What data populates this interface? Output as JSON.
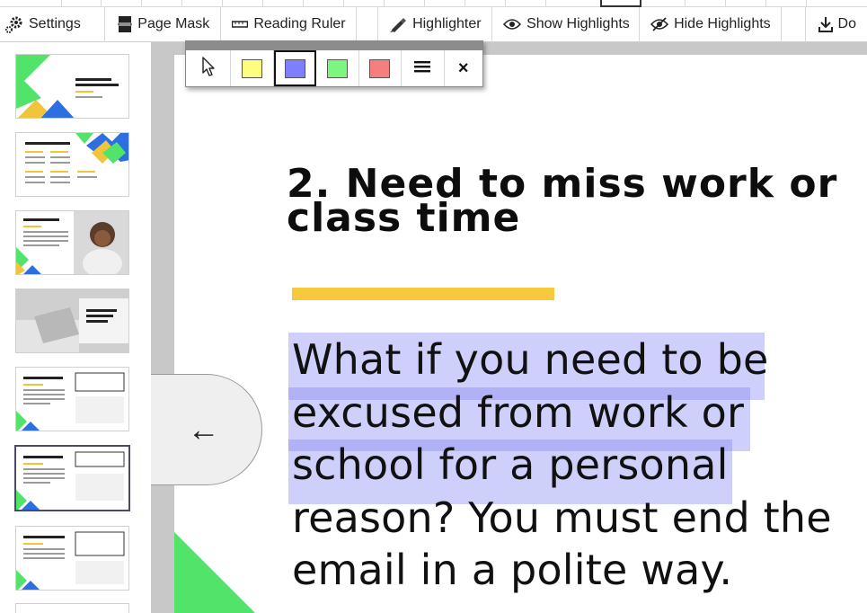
{
  "toolbar": {
    "settings_label": "Settings",
    "page_mask_label": "Page Mask",
    "reading_ruler_label": "Reading Ruler",
    "highlighter_label": "Highlighter",
    "show_highlights_label": "Show Highlights",
    "hide_highlights_label": "Hide Highlights",
    "download_label": "Do"
  },
  "highlighter_popup": {
    "tools": [
      "pointer-icon",
      "yellow",
      "blue",
      "green",
      "red",
      "menu-icon",
      "close-icon"
    ],
    "colors": {
      "yellow": "#fdfd80",
      "blue": "#7f7ffd",
      "green": "#7df57f",
      "red": "#f57f7f"
    },
    "selected": "blue",
    "close_glyph": "×"
  },
  "thumbnails": {
    "t1": {
      "title": "How to Write Email Closing Lines"
    },
    "t2": {
      "title": "Questions to consider"
    },
    "t3": {
      "title": "Introduction"
    },
    "t4": {
      "title": "Let's explore the closing email lines"
    },
    "t5": {
      "title": "1. Send off a job application"
    },
    "t6": {
      "title": "2. Need to miss work or class time"
    },
    "t7": {
      "title": "3. Request an interview or meeting"
    },
    "selected_index": 6
  },
  "slide": {
    "title": "2. Need to miss work or class time",
    "body": "What if you need to be excused from work or school for a personal reason? You must end the email in a polite way.",
    "accent_yellow": "#f8c93c",
    "accent_green": "#52e36a",
    "highlight_color": "#8282f5"
  },
  "back_arrow": "←"
}
